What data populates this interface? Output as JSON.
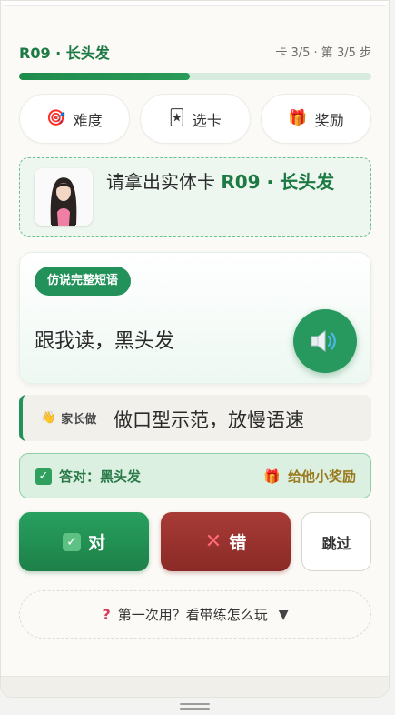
{
  "header": {
    "title": "R09 · 长头发",
    "progress_text": "卡 3/5 · 第 3/5 步",
    "progress_fraction": 0.485
  },
  "tabs": [
    {
      "label": "难度",
      "icon": "target-icon"
    },
    {
      "label": "选卡",
      "icon": "card-icon"
    },
    {
      "label": "奖励",
      "icon": "gift-icon"
    }
  ],
  "card_prompt": {
    "prefix": "请拿出实体卡 ",
    "card_name": "R09 · 长头发"
  },
  "phrase_card": {
    "mode_label": "仿说完整短语",
    "phrase": "跟我读，黑头发"
  },
  "parent": {
    "label": "家长做",
    "instruction": "做口型示范，放慢语速"
  },
  "answer": {
    "label": "答对：黑头发",
    "reward_label": "给他小奖励"
  },
  "actions": {
    "correct_label": "对",
    "wrong_label": "错",
    "skip_label": "跳过"
  },
  "help": {
    "label": "第一次用？看带练怎么玩"
  },
  "colors": {
    "brand_green": "#23915a",
    "wrong_red": "#9a322d",
    "reward_gold": "#9a7a1e"
  }
}
